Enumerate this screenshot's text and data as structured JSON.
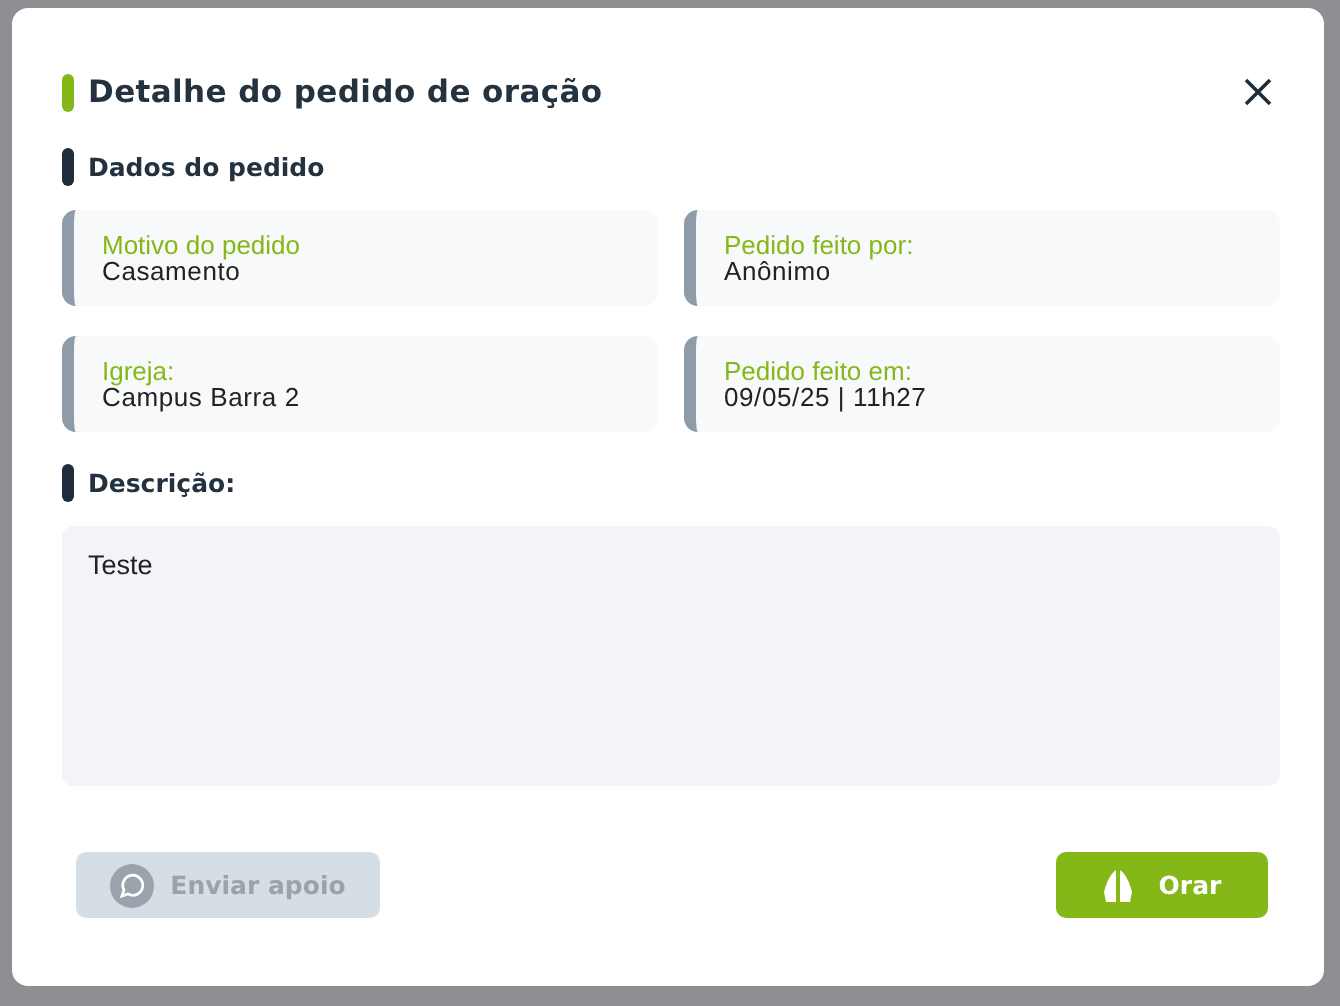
{
  "dialog": {
    "title": "Detalhe do pedido de oração"
  },
  "details": {
    "heading": "Dados do pedido",
    "fields": [
      {
        "label": "Motivo do pedido",
        "value": "Casamento"
      },
      {
        "label": "Pedido feito por:",
        "value": "Anônimo"
      },
      {
        "label": "Igreja:",
        "value": "Campus Barra 2"
      },
      {
        "label": "Pedido feito em:",
        "value": "09/05/25 | 11h27"
      }
    ]
  },
  "description": {
    "heading": "Descrição:",
    "text": "Teste"
  },
  "buttons": [
    {
      "kind": "support",
      "label": "Enviar apoio",
      "disabled": true
    },
    {
      "kind": "pray",
      "label": "Orar",
      "disabled": false
    }
  ]
}
